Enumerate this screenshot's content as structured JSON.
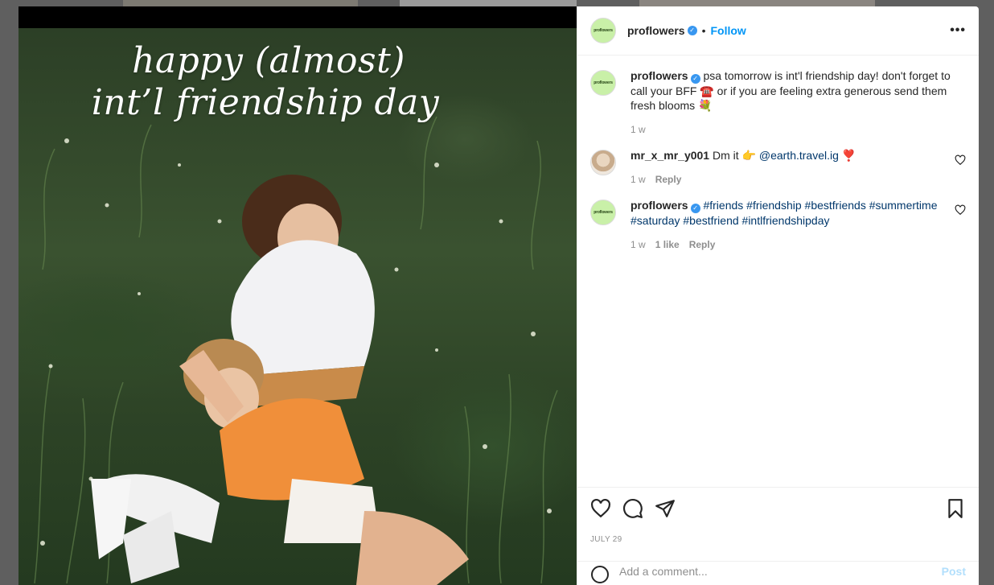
{
  "post": {
    "headline_line1": "happy (almost)",
    "headline_line2": "int’l friendship day"
  },
  "header": {
    "username": "proflowers",
    "avatar_text": "proflowers",
    "dot": "•",
    "follow_label": "Follow",
    "more_label": "•••"
  },
  "comments": [
    {
      "username": "proflowers",
      "avatar_text": "proflowers",
      "text": "psa tomorrow is int'l friendship day! don't forget to call your BFF ☎️ or if you are feeling extra generous send them fresh blooms 💐",
      "time": "1 w"
    },
    {
      "username": "mr_x_mr_y001",
      "text_before": "Dm it 👉",
      "mention": "@earth.travel.ig",
      "text_after": "❣️",
      "time": "1 w",
      "reply": "Reply"
    },
    {
      "username": "proflowers",
      "avatar_text": "proflowers",
      "hashtags": "#friends #friendship #bestfriends #summertime #saturday #bestfriend #intlfriendshipday",
      "time": "1 w",
      "likes": "1 like",
      "reply": "Reply"
    }
  ],
  "footer": {
    "date": "JULY 29",
    "add_comment_placeholder": "Add a comment...",
    "post_label": "Post"
  },
  "colors": {
    "link": "#0095f6",
    "hashtag": "#00376b",
    "avatar_bg": "#c9f0a8"
  }
}
